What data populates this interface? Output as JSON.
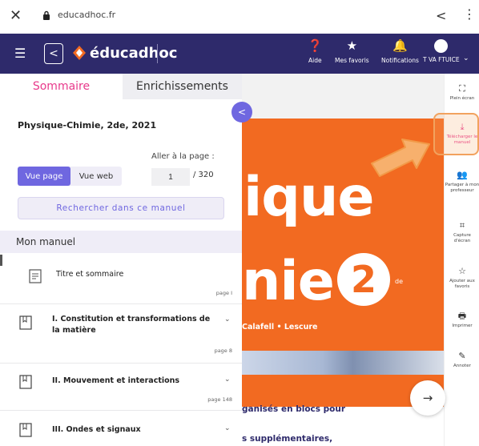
{
  "browser": {
    "url": "educadhoc.fr"
  },
  "appbar": {
    "logo": "éducadhoc",
    "items": [
      {
        "label": "Aide",
        "icon": "help-icon"
      },
      {
        "label": "Mes favoris",
        "icon": "star-icon"
      },
      {
        "label": "Notifications",
        "icon": "bell-icon"
      },
      {
        "label": "T VA FTUICE",
        "icon": "avatar"
      }
    ]
  },
  "panel": {
    "tabs": [
      "Sommaire",
      "Enrichissements"
    ],
    "book_title": "Physique-Chimie, 2de, 2021",
    "goto_label": "Aller à la page :",
    "view_page": "Vue page",
    "view_web": "Vue web",
    "page_value": "1",
    "page_total": "/ 320",
    "search_label": "Rechercher dans ce manuel",
    "section": "Mon manuel",
    "toc": [
      {
        "title": "Titre et sommaire",
        "page": "page I"
      },
      {
        "title": "I. Constitution et transformations de la matière",
        "page": "page 8"
      },
      {
        "title": "II. Mouvement et interactions",
        "page": "page 148"
      },
      {
        "title": "III. Ondes et signaux",
        "page": ""
      }
    ]
  },
  "document": {
    "word1": "ique",
    "word2": "nie",
    "level_number": "2",
    "level_sup": "de",
    "authors": "Calafell • Lescure",
    "line1": "ganisés en blocs pour",
    "line2": "s supplémentaires,"
  },
  "toolbar": [
    {
      "label": "Plein écran",
      "icon": "fullscreen-icon"
    },
    {
      "label": "Télécharger le manuel",
      "icon": "download-icon"
    },
    {
      "label": "Partager à mon professeur",
      "icon": "share-people-icon"
    },
    {
      "label": "Capture d'écran",
      "icon": "screenshot-icon"
    },
    {
      "label": "Ajouter aux favoris",
      "icon": "star-outline-icon"
    },
    {
      "label": "Imprimer",
      "icon": "print-icon"
    },
    {
      "label": "Annoter",
      "icon": "annotate-icon"
    }
  ],
  "colors": {
    "header": "#2e2a6b",
    "accent": "#6f67e0",
    "pink": "#e8398b",
    "orange": "#f26a21"
  }
}
